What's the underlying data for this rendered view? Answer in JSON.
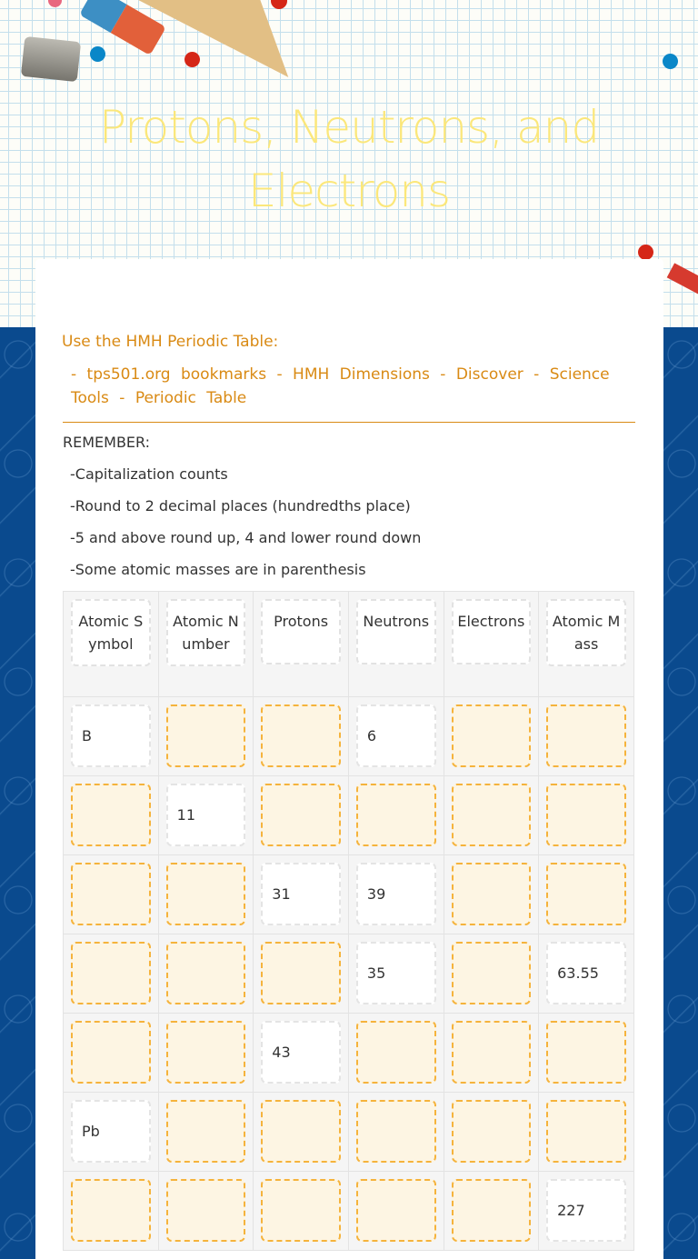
{
  "header": {
    "title": "Protons, Neutrons, and Electrons"
  },
  "instructions": {
    "heading": "Use the HMH Periodic Table:",
    "path": "- tps501.org bookmarks  -  HMH Dimensions  -  Discover  -  Science Tools  -  Periodic Table"
  },
  "remember": {
    "heading": "REMEMBER:",
    "items": [
      "-Capitalization counts",
      "-Round to 2 decimal places (hundredths place)",
      "-5 and above round up, 4 and lower round down",
      "-Some atomic masses are in parenthesis"
    ]
  },
  "table": {
    "headers": [
      "Atomic Symbol",
      "Atomic Number",
      "Protons",
      "Neutrons",
      "Electrons",
      "Atomic Mass"
    ],
    "rows": [
      [
        "B",
        "",
        "",
        "6",
        "",
        ""
      ],
      [
        "",
        "11",
        "",
        "",
        "",
        ""
      ],
      [
        "",
        "",
        "31",
        "39",
        "",
        ""
      ],
      [
        "",
        "",
        "",
        "35",
        "",
        "63.55"
      ],
      [
        "",
        "",
        "43",
        "",
        "",
        ""
      ],
      [
        "Pb",
        "",
        "",
        "",
        "",
        ""
      ],
      [
        "",
        "",
        "",
        "",
        "",
        "227"
      ]
    ]
  },
  "colors": {
    "title": "#fbe77a",
    "instruction_text": "#d98a14",
    "blank_border": "#f5b33c",
    "blank_fill": "#fdf5e3",
    "side_bg": "#0a4a8e"
  }
}
